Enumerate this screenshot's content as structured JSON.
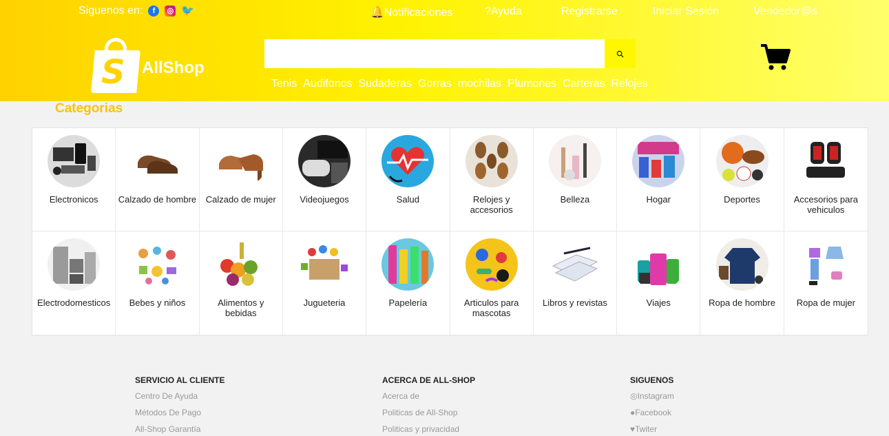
{
  "topbar": {
    "follow_label": "Siguenos en:",
    "links": [
      "🔔Notificaciones",
      "?Ayuda",
      "Registrarse",
      "Iniciar Sesión",
      "Vendedor@s"
    ]
  },
  "logo": {
    "text": "AllShop",
    "initial": "S"
  },
  "search": {
    "value": "",
    "placeholder": ""
  },
  "quick_links": [
    "Tenis",
    "Audifonos",
    "Sudaderas",
    "Gorras",
    "mochilas",
    "Plumones",
    "Carteras",
    "Relojes"
  ],
  "categories_title": "Categorias",
  "categories": [
    {
      "label": "Electronicos"
    },
    {
      "label": "Calzado de hombre"
    },
    {
      "label": "Calzado de mujer"
    },
    {
      "label": "Videojuegos"
    },
    {
      "label": "Salud"
    },
    {
      "label": "Relojes y accesorios"
    },
    {
      "label": "Belleza"
    },
    {
      "label": "Hogar"
    },
    {
      "label": "Deportes"
    },
    {
      "label": "Accesorios para vehiculos"
    },
    {
      "label": "Electrodomesticos"
    },
    {
      "label": "Bebes y niños"
    },
    {
      "label": "Alimentos y bebidas"
    },
    {
      "label": "Jugueteria"
    },
    {
      "label": "Papelería"
    },
    {
      "label": "Articulos para mascotas"
    },
    {
      "label": "Libros y revistas"
    },
    {
      "label": "Viajes"
    },
    {
      "label": "Ropa de hombre"
    },
    {
      "label": "Ropa de mujer"
    }
  ],
  "footer": {
    "service": {
      "title": "SERVICIO AL CLIENTE",
      "links": [
        "Centro De Ayuda",
        "Métodos De Pago",
        "All-Shop Garantía"
      ]
    },
    "about": {
      "title": "ACERCA DE ALL-SHOP",
      "links": [
        "Acerca de",
        "Politicas de All-Shop",
        "Politicas y privacidad"
      ]
    },
    "follow": {
      "title": "SIGUENOS",
      "links": [
        "Instagram",
        "Facebook",
        "Twiter"
      ]
    }
  },
  "colors": {
    "brand_yellow": "#ffd200",
    "accent": "#ffc107"
  }
}
